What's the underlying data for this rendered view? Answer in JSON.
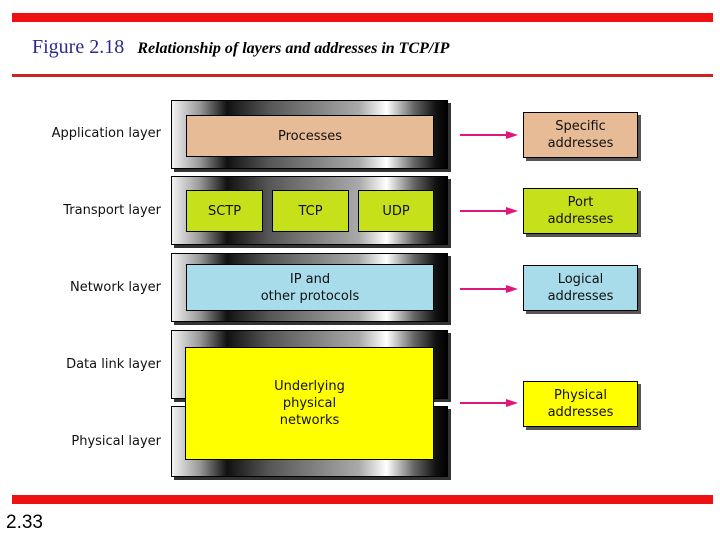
{
  "figure": {
    "number": "Figure 2.18",
    "caption": "Relationship of layers and addresses in TCP/IP"
  },
  "layers": [
    {
      "label": "Application layer"
    },
    {
      "label": "Transport layer"
    },
    {
      "label": "Network layer"
    },
    {
      "label": "Data link layer"
    },
    {
      "label": "Physical layer"
    }
  ],
  "protocols": {
    "application": "Processes",
    "transport": [
      "SCTP",
      "TCP",
      "UDP"
    ],
    "network_line1": "IP and",
    "network_line2": "other protocols",
    "physical_line1": "Underlying",
    "physical_line2": "physical",
    "physical_line3": "networks"
  },
  "addresses": [
    {
      "line1": "Specific",
      "line2": "addresses",
      "color": "#e6bb96"
    },
    {
      "line1": "Port",
      "line2": "addresses",
      "color": "#c6e01a"
    },
    {
      "line1": "Logical",
      "line2": "addresses",
      "color": "#a8dcea"
    },
    {
      "line1": "Physical",
      "line2": "addresses",
      "color": "#ffff00"
    }
  ],
  "colors": {
    "rule": "#ee1111",
    "arrow": "#e0177a",
    "figure_number": "#2b2b8c"
  },
  "slide_number": "2.33"
}
